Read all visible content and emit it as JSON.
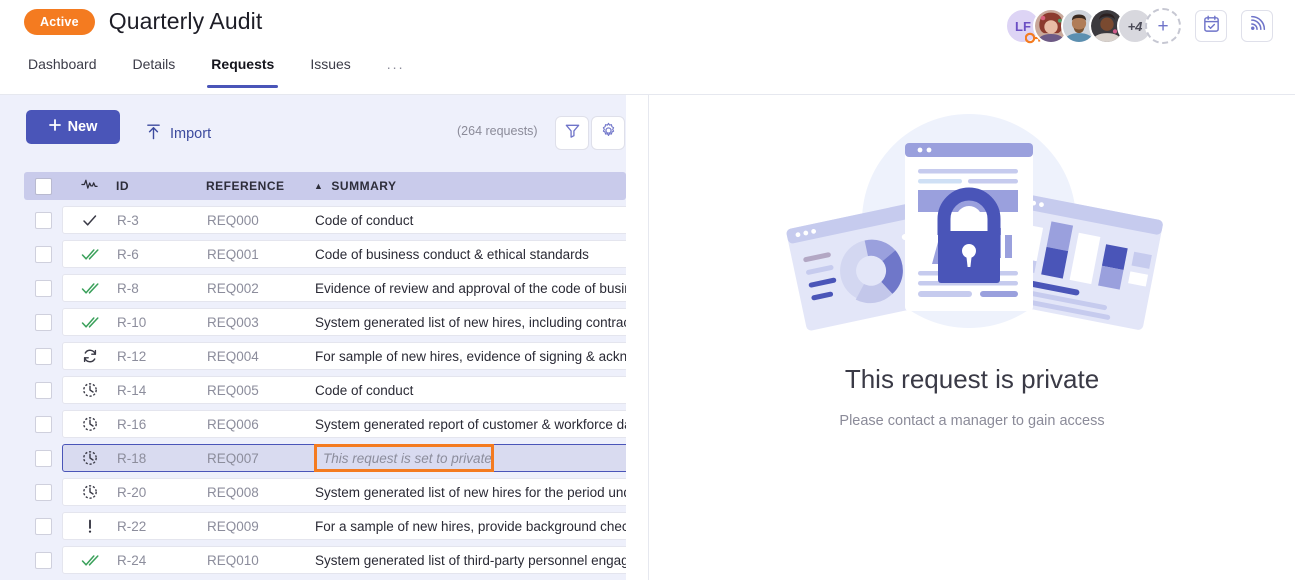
{
  "header": {
    "status_label": "Active",
    "title": "Quarterly Audit",
    "tabs": [
      {
        "label": "Dashboard",
        "active": false
      },
      {
        "label": "Details",
        "active": false
      },
      {
        "label": "Requests",
        "active": true
      },
      {
        "label": "Issues",
        "active": false
      },
      {
        "label": "...",
        "active": false
      }
    ],
    "avatars": {
      "initials": "LF",
      "badge_icon": "key-icon",
      "photo_count": 3,
      "overflow_label": "+4",
      "add_label": "+"
    },
    "actions": [
      {
        "icon": "calendar-check-icon",
        "name": "calendar-button"
      },
      {
        "icon": "activity-feed-icon",
        "name": "feed-button"
      }
    ]
  },
  "toolbar": {
    "new_label": "New",
    "import_label": "Import",
    "count_label": "(264 requests)",
    "filter_icon": "filter-funnel-icon",
    "settings_icon": "gear-icon"
  },
  "table": {
    "columns": [
      {
        "key": "check",
        "label": ""
      },
      {
        "key": "status",
        "label": ""
      },
      {
        "key": "id",
        "label": "ID"
      },
      {
        "key": "reference",
        "label": "REFERENCE"
      },
      {
        "key": "summary",
        "label": "SUMMARY"
      }
    ],
    "sort": {
      "column": "summary",
      "direction": "asc",
      "caret": "▲"
    },
    "rows": [
      {
        "status": "check-single-icon",
        "id": "R-3",
        "reference": "REQ000",
        "summary": "Code of conduct",
        "selected": false,
        "private": false
      },
      {
        "status": "check-double-icon",
        "id": "R-6",
        "reference": "REQ001",
        "summary": "Code of business conduct & ethical standards",
        "selected": false,
        "private": false
      },
      {
        "status": "check-double-icon",
        "id": "R-8",
        "reference": "REQ002",
        "summary": "Evidence of review and approval of the code of business conduct",
        "selected": false,
        "private": false
      },
      {
        "status": "check-double-icon",
        "id": "R-10",
        "reference": "REQ003",
        "summary": "System generated list of new hires, including contractors",
        "selected": false,
        "private": false
      },
      {
        "status": "sync-icon",
        "id": "R-12",
        "reference": "REQ004",
        "summary": "For sample of new hires, evidence of signing & acknowledgement",
        "selected": false,
        "private": false
      },
      {
        "status": "clock-pending-icon",
        "id": "R-14",
        "reference": "REQ005",
        "summary": "Code of conduct",
        "selected": false,
        "private": false
      },
      {
        "status": "clock-pending-icon",
        "id": "R-16",
        "reference": "REQ006",
        "summary": "System generated report of customer & workforce data",
        "selected": false,
        "private": false
      },
      {
        "status": "clock-pending-icon",
        "id": "R-18",
        "reference": "REQ007",
        "summary": "This request is set to private",
        "selected": true,
        "private": true
      },
      {
        "status": "clock-pending-icon",
        "id": "R-20",
        "reference": "REQ008",
        "summary": "System generated list of new hires for the period under review",
        "selected": false,
        "private": false
      },
      {
        "status": "alert-icon",
        "id": "R-22",
        "reference": "REQ009",
        "summary": "For a sample of new hires, provide background check evidence",
        "selected": false,
        "private": false
      },
      {
        "status": "check-double-icon",
        "id": "R-24",
        "reference": "REQ010",
        "summary": "System generated list of third-party personnel engaged",
        "selected": false,
        "private": false
      }
    ]
  },
  "detail_panel": {
    "illustration": "private-document-lock-illustration",
    "title": "This request is private",
    "subtitle": "Please contact a manager to gain access"
  },
  "colors": {
    "accent": "#4a55b8",
    "status_pill": "#f47b20",
    "highlight_box": "#f47b20",
    "left_pane_bg": "#eef0fb",
    "table_header_bg": "#c9cbeb",
    "selected_row_bg": "#d9dbf0"
  }
}
